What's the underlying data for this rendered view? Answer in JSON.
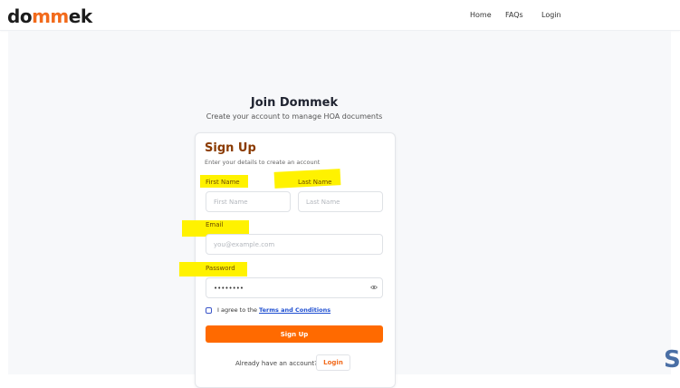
{
  "brand": {
    "logo_prefix": "do",
    "logo_accent": "mm",
    "logo_suffix": "ek"
  },
  "nav": {
    "home": "Home",
    "faqs": "FAQs",
    "login": "Login"
  },
  "hero": {
    "title": "Join Dommek",
    "subtitle": "Create your account to manage HOA documents"
  },
  "form": {
    "title": "Sign Up",
    "subtitle": "Enter your details to create an account",
    "first_name_label": "First Name",
    "first_name_placeholder": "First Name",
    "last_name_label": "Last Name",
    "last_name_placeholder": "Last Name",
    "email_label": "Email",
    "email_placeholder": "you@example.com",
    "password_label": "Password",
    "password_value": "••••••••",
    "agree_text": "I agree to the ",
    "terms_link": "Terms and Conditions",
    "submit_label": "Sign Up",
    "already_text": "Already have an account?",
    "login_label": "Login"
  },
  "corner_glyph": "S",
  "colors": {
    "accent": "#ff6a00",
    "highlight": "#fff200",
    "link": "#1f4fd1"
  }
}
